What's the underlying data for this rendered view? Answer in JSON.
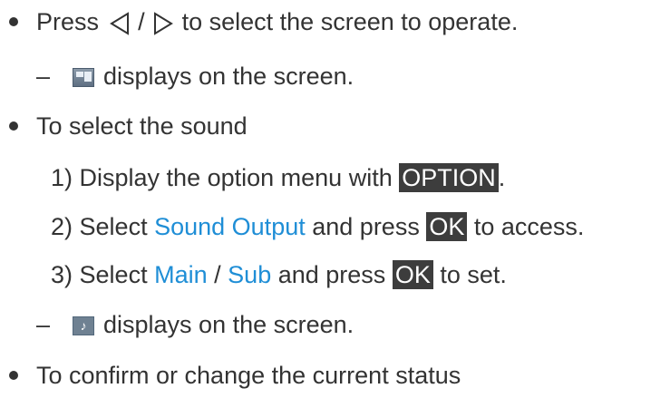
{
  "items": {
    "press": {
      "prefix": "Press",
      "separator": "/",
      "suffix": "to select the screen to operate."
    },
    "screen_note": {
      "dash": "–",
      "text": "displays on the screen.",
      "icon": "sub-screen-icon"
    },
    "select_sound": {
      "text": "To select the sound"
    },
    "step1": {
      "num": "1)",
      "text": "Display the option menu with",
      "key": "OPTION",
      "end": "."
    },
    "step2": {
      "num": "2)",
      "pre": "Select",
      "link": "Sound Output",
      "mid": "and press",
      "key": "OK",
      "end": "to access."
    },
    "step3": {
      "num": "3)",
      "pre": "Select",
      "link1": "Main",
      "sep": "/",
      "link2": "Sub",
      "mid": "and press",
      "key": "OK",
      "end": "to set."
    },
    "sound_note": {
      "dash": "–",
      "text": "displays on the screen.",
      "icon": "music-note-icon"
    },
    "confirm": {
      "text": "To confirm or change the current status"
    }
  },
  "colors": {
    "text": "#333333",
    "link": "#1f8ed6",
    "key_bg": "#3d3d3d"
  }
}
